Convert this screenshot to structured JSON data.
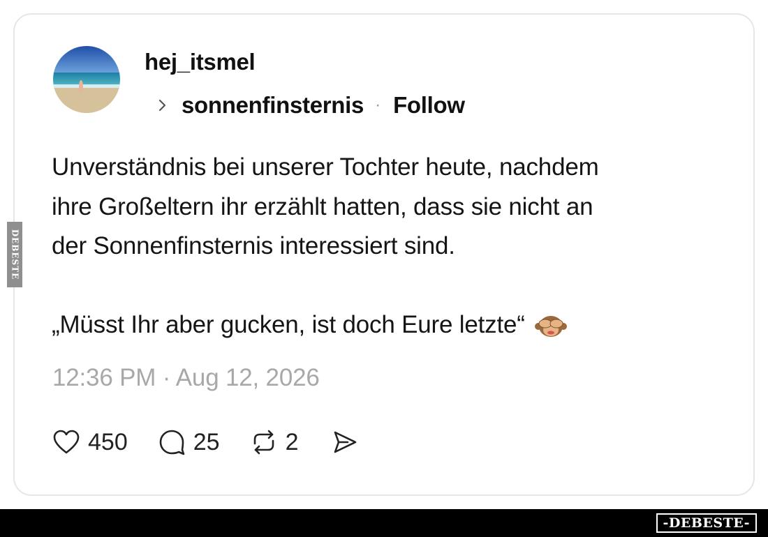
{
  "post": {
    "username": "hej_itsmel",
    "topic": "sonnenfinsternis",
    "follow_label": "Follow",
    "body_lines": [
      "Unverständnis bei unserer Tochter heute, nachdem",
      "ihre Großeltern ihr erzählt hatten, dass sie nicht an",
      "der Sonnenfinsternis interessiert sind."
    ],
    "quote": "„Müsst Ihr aber gucken, ist doch Eure letzte“",
    "emoji": "see-no-evil-monkey",
    "timestamp": "12:36 PM · Aug 12, 2026"
  },
  "actions": {
    "likes": "450",
    "replies": "25",
    "reposts": "2"
  },
  "icons": {
    "like": "heart-icon",
    "reply": "comment-bubble-icon",
    "repost": "repost-icon",
    "share": "send-icon",
    "topic": "chevron-right-icon"
  },
  "watermark": {
    "side": "DEBESTE",
    "bottom": "-DEBESTE-"
  },
  "colors": {
    "text": "#111111",
    "muted": "#a8a8a8",
    "card_border": "#e6e6e6",
    "bottom_bar": "#000000"
  }
}
